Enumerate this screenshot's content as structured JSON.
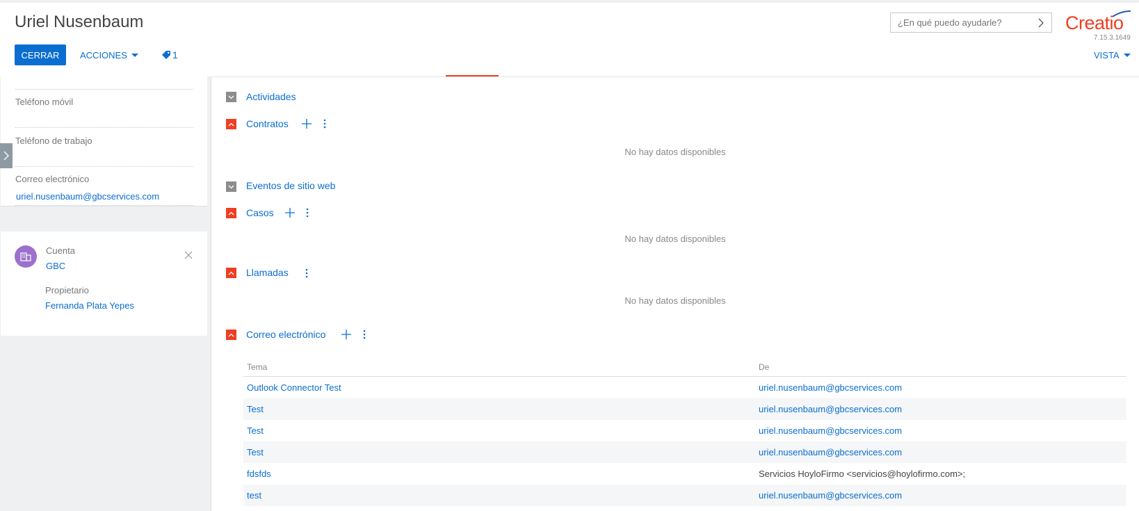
{
  "header": {
    "title": "Uriel Nusenbaum",
    "close_label": "CERRAR",
    "actions_label": "ACCIONES",
    "tag_count": "1",
    "search_placeholder": "¿En qué puedo ayudarle?",
    "logo_text": "Creatio",
    "version": "7.15.3.1649",
    "view_label": "VISTA"
  },
  "contact_panel": {
    "mobile_label": "Teléfono móvil",
    "work_phone_label": "Teléfono de trabajo",
    "email_label": "Correo electrónico",
    "email_value": "uriel.nusenbaum@gbcservices.com"
  },
  "account_panel": {
    "account_label": "Cuenta",
    "account_value": "GBC",
    "owner_label": "Propietario",
    "owner_value": "Fernanda Plata Yepes"
  },
  "sections": {
    "actividades": "Actividades",
    "contratos": "Contratos",
    "eventos": "Eventos de sitio web",
    "casos": "Casos",
    "llamadas": "Llamadas",
    "correo": "Correo electrónico",
    "no_data": "No hay datos disponibles"
  },
  "email_grid": {
    "columns": [
      "Tema",
      "De"
    ],
    "rows": [
      {
        "tema": "Outlook Connector Test",
        "de": "uriel.nusenbaum@gbcservices.com"
      },
      {
        "tema": "Test",
        "de": "uriel.nusenbaum@gbcservices.com"
      },
      {
        "tema": "Test",
        "de": "uriel.nusenbaum@gbcservices.com"
      },
      {
        "tema": "Test",
        "de": "uriel.nusenbaum@gbcservices.com"
      },
      {
        "tema": "fdsfds",
        "de": "Servicios HoyloFirmo <servicios@hoylofirmo.com>;"
      },
      {
        "tema": "test",
        "de": "uriel.nusenbaum@gbcservices.com"
      }
    ]
  },
  "colors": {
    "accent": "#0a6ed1",
    "brand": "#ef3e23",
    "avatar": "#9b71ce"
  }
}
